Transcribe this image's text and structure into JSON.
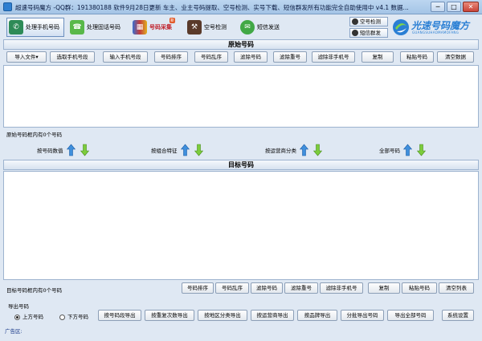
{
  "window": {
    "title": "超速号码魔方 -QQ群：191380188 软件9月28日更新 车主、业主号码提取、空号检测、实号下载、短信群发所有功能完全自助使用中  v4.1 数据...",
    "minimize": "─",
    "maximize": "□",
    "close": "✕"
  },
  "toolbar": {
    "buttons": [
      {
        "label": "处理手机号码",
        "color": "#2e8b57"
      },
      {
        "label": "处理固话号码",
        "color": "#59b84a"
      },
      {
        "label": "号码采集",
        "color": "#b5353d",
        "badge": "新"
      },
      {
        "label": "空号检测",
        "color": "#5a3a2a"
      },
      {
        "label": "短信发送",
        "color": "#41a845"
      }
    ],
    "side_buttons": [
      "空号检测",
      "短信群发"
    ]
  },
  "logo": {
    "title": "光速号码魔方",
    "subtitle": "GUANGSUHAOMAMOFANG",
    "color": "#2a7fd4"
  },
  "source_panel": {
    "title": "原始号码",
    "buttons": [
      "导入文件",
      "选取手机号段",
      "输入手机号段",
      "号码排序",
      "号码乱序",
      "滤除号码",
      "滤除重号",
      "滤除非手机号",
      "复制",
      "粘贴号码",
      "清空数据"
    ],
    "import_arrow": "▾",
    "status": "原始号码框内有0个号码"
  },
  "sort_bar": {
    "groups": [
      "按号码数值",
      "按组合特征",
      "按运营商分类",
      "全部号码"
    ]
  },
  "target_panel": {
    "title": "目标号码",
    "status": "目标号码框内有0个号码",
    "buttons": [
      "号码排序",
      "号码乱序",
      "滤除号码",
      "滤除重号",
      "滤除非手机号",
      "复制",
      "粘贴号码",
      "清空列表"
    ]
  },
  "export": {
    "label": "导出号码",
    "radio_up": "上方号码",
    "radio_down": "下方号码",
    "buttons": [
      "按号码段导出",
      "按重复次数导出",
      "按地区分类导出",
      "按运营商导出",
      "按品牌导出",
      "分批导出号码",
      "导出全部号码"
    ],
    "settings": "系统设置"
  },
  "ad": {
    "label": "广告区:"
  }
}
